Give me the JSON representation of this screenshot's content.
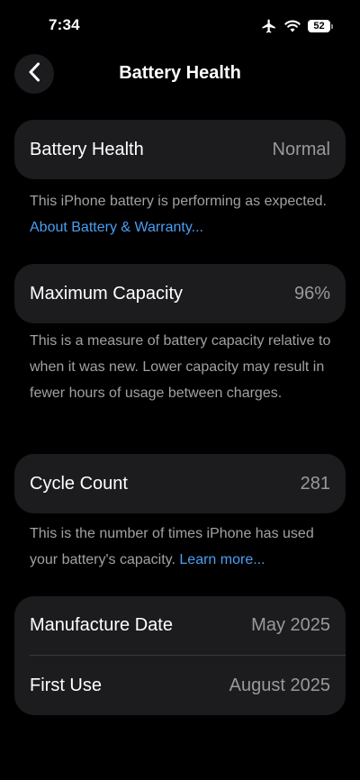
{
  "status_bar": {
    "time": "7:34",
    "battery_percent": "52",
    "icons": [
      "airplane-icon",
      "wifi-icon",
      "battery-icon"
    ]
  },
  "nav": {
    "title": "Battery Health",
    "back_icon": "chevron-left-icon"
  },
  "battery_health": {
    "label": "Battery Health",
    "value": "Normal",
    "description": "This iPhone battery is performing as expected.",
    "link": "About Battery & Warranty..."
  },
  "maximum_capacity": {
    "label": "Maximum Capacity",
    "value": "96%",
    "description": "This is a measure of battery capacity relative to when it was new. Lower capacity may result in fewer hours of usage between charges."
  },
  "cycle_count": {
    "label": "Cycle Count",
    "value": "281",
    "description": "This is the number of times iPhone has used your battery's capacity.",
    "link": "Learn more..."
  },
  "dates": {
    "manufacture_label": "Manufacture Date",
    "manufacture_value": "May 2025",
    "first_use_label": "First Use",
    "first_use_value": "August 2025"
  },
  "colors": {
    "background": "#000000",
    "card": "#1c1c1e",
    "secondary_text": "#98989f",
    "link": "#4a9ff5"
  }
}
